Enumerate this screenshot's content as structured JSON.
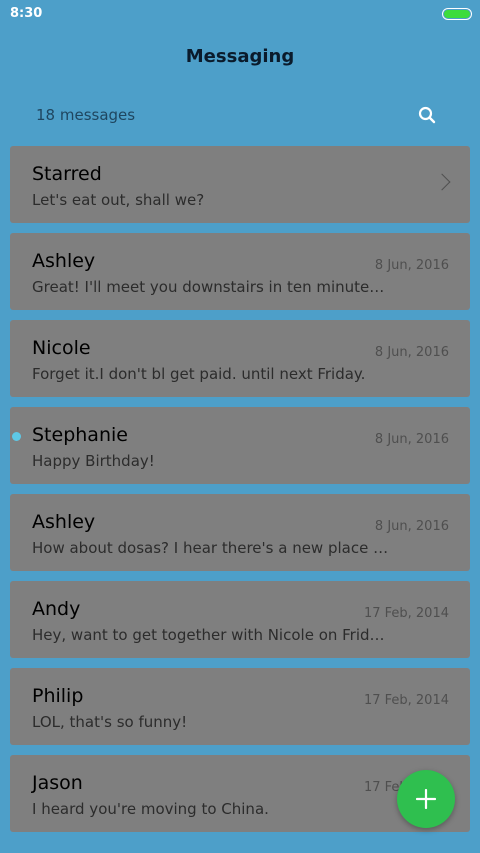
{
  "status_bar": {
    "time": "8:30"
  },
  "header": {
    "title": "Messaging",
    "count": "18 messages"
  },
  "colors": {
    "accent": "#2fbf4f",
    "unread": "#5ec8e6",
    "background": "#4d9fc9",
    "card": "#7f7f7f"
  },
  "icons": {
    "search": "search-icon",
    "add": "plus-icon",
    "chevron": "chevron-right-icon"
  },
  "starred": {
    "name": "Starred",
    "preview": "Let's eat out, shall we?"
  },
  "conversations": [
    {
      "name": "Ashley",
      "preview": "Great! I'll meet you downstairs in ten minutes. Don't be late!",
      "date": "8 Jun, 2016",
      "unread": false
    },
    {
      "name": "Nicole",
      "preview": "Forget it.I don't bl get paid. until next Friday.",
      "date": "8 Jun, 2016",
      "unread": false
    },
    {
      "name": "Stephanie",
      "preview": "Happy Birthday!",
      "date": "8 Jun, 2016",
      "unread": true
    },
    {
      "name": "Ashley",
      "preview": "How about dosas? I hear there's a new place downtown.",
      "date": "8 Jun, 2016",
      "unread": false
    },
    {
      "name": "Andy",
      "preview": "Hey, want to get together with Nicole on Friday?",
      "date": "17 Feb, 2014",
      "unread": false
    },
    {
      "name": "Philip",
      "preview": "LOL, that's so funny!",
      "date": "17 Feb, 2014",
      "unread": false
    },
    {
      "name": "Jason",
      "preview": "I heard you're moving to China.",
      "date": "17 Feb, 2014",
      "unread": false
    }
  ]
}
